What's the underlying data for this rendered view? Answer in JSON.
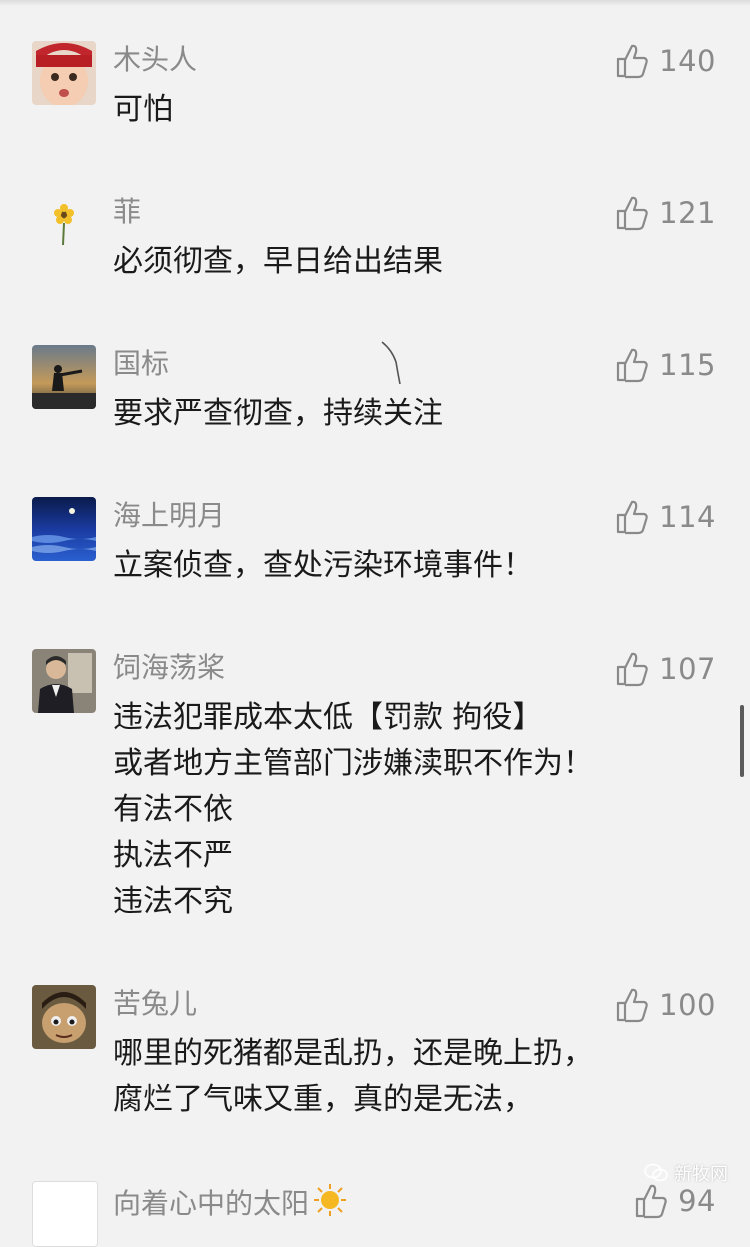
{
  "comments": [
    {
      "name": "木头人",
      "lines": [
        "可怕"
      ],
      "likes": "140",
      "avatar": "baby-avatar"
    },
    {
      "name": "菲",
      "lines": [
        "必须彻查，早日给出结果"
      ],
      "likes": "121",
      "avatar": "flower-avatar"
    },
    {
      "name": "国标",
      "lines": [
        "要求严查彻查，持续关注"
      ],
      "likes": "115",
      "avatar": "silhouette-avatar"
    },
    {
      "name": "海上明月",
      "lines": [
        "立案侦查，查处污染环境事件！"
      ],
      "likes": "114",
      "avatar": "moon-sea-avatar"
    },
    {
      "name": "饲海荡桨",
      "lines": [
        "违法犯罪成本太低【罚款  拘役】",
        "或者地方主管部门涉嫌渎职不作为！",
        "有法不依",
        "执法不严",
        "违法不究"
      ],
      "likes": "107",
      "avatar": "man-avatar"
    },
    {
      "name": "苦兔儿",
      "lines": [
        "哪里的死猪都是乱扔，还是晚上扔，",
        "腐烂了气味又重，真的是无法，"
      ],
      "likes": "100",
      "avatar": "cartoon-avatar"
    },
    {
      "name": "向着心中的太阳",
      "lines": [],
      "likes": "94",
      "avatar": "white-avatar"
    }
  ],
  "watermark": {
    "text": "新牧网",
    "icon": "wechat-icon"
  },
  "colors": {
    "background": "#f2f2f2",
    "name": "#8a8a8a",
    "text": "#1a1a1a",
    "likes": "#8a8a8a"
  }
}
